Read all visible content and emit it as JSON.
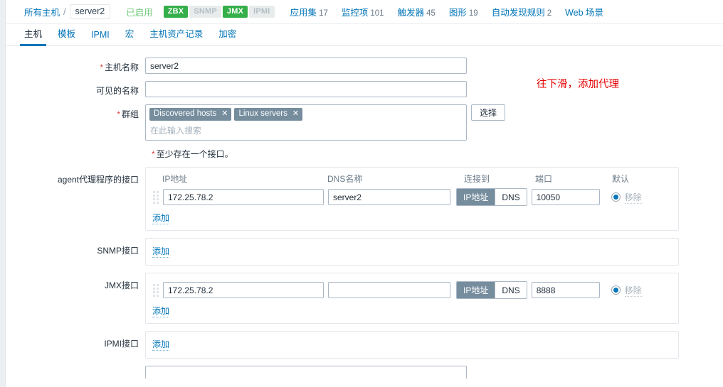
{
  "breadcrumb": {
    "all_hosts": "所有主机",
    "separator": "/",
    "current": "server2"
  },
  "header": {
    "status": "已启用",
    "badges": [
      {
        "label": "ZBX",
        "active": true
      },
      {
        "label": "SNMP",
        "active": false
      },
      {
        "label": "JMX",
        "active": true
      },
      {
        "label": "IPMI",
        "active": false
      }
    ],
    "links": [
      {
        "label": "应用集",
        "count": "17"
      },
      {
        "label": "监控项",
        "count": "101"
      },
      {
        "label": "触发器",
        "count": "45"
      },
      {
        "label": "图形",
        "count": "19"
      },
      {
        "label": "自动发现规则",
        "count": "2"
      },
      {
        "label": "Web 场景",
        "count": ""
      }
    ]
  },
  "tabs": [
    {
      "label": "主机",
      "active": true
    },
    {
      "label": "模板",
      "active": false
    },
    {
      "label": "IPMI",
      "active": false
    },
    {
      "label": "宏",
      "active": false
    },
    {
      "label": "主机资产记录",
      "active": false
    },
    {
      "label": "加密",
      "active": false
    }
  ],
  "form": {
    "host_name": {
      "label": "主机名称",
      "required": true,
      "value": "server2"
    },
    "visible_name": {
      "label": "可见的名称",
      "required": false,
      "value": "",
      "placeholder": ""
    },
    "groups": {
      "label": "群组",
      "required": true,
      "chips": [
        "Discovered hosts",
        "Linux servers"
      ],
      "remove_icon": "✕",
      "placeholder": "在此输入搜索",
      "select_button": "选择"
    },
    "interfaces_note": "至少存在一个接口。",
    "columns": {
      "ip": "IP地址",
      "dns": "DNS名称",
      "connect_to": "连接到",
      "port": "端口",
      "default": "默认"
    },
    "connect_options": {
      "ip": "IP地址",
      "dns": "DNS"
    },
    "add_label": "添加",
    "remove_label": "移除",
    "agent_interface": {
      "label": "agent代理程序的接口",
      "rows": [
        {
          "ip": "172.25.78.2",
          "dns": "server2",
          "connect_to": "IP地址",
          "port": "10050",
          "is_default": true
        }
      ]
    },
    "snmp_interface": {
      "label": "SNMP接口",
      "rows": []
    },
    "jmx_interface": {
      "label": "JMX接口",
      "rows": [
        {
          "ip": "172.25.78.2",
          "dns": "",
          "connect_to": "IP地址",
          "port": "8888",
          "is_default": true
        }
      ]
    },
    "ipmi_interface": {
      "label": "IPMI接口",
      "rows": []
    }
  },
  "annotation": {
    "text": "往下滑，添加代理"
  },
  "colors": {
    "link": "#0275b8",
    "badge_active": "#34af4a",
    "badge_inactive": "#e8eced",
    "chip": "#768d9e",
    "annotation": "#e60000",
    "enabled_text": "#72ca7b"
  }
}
